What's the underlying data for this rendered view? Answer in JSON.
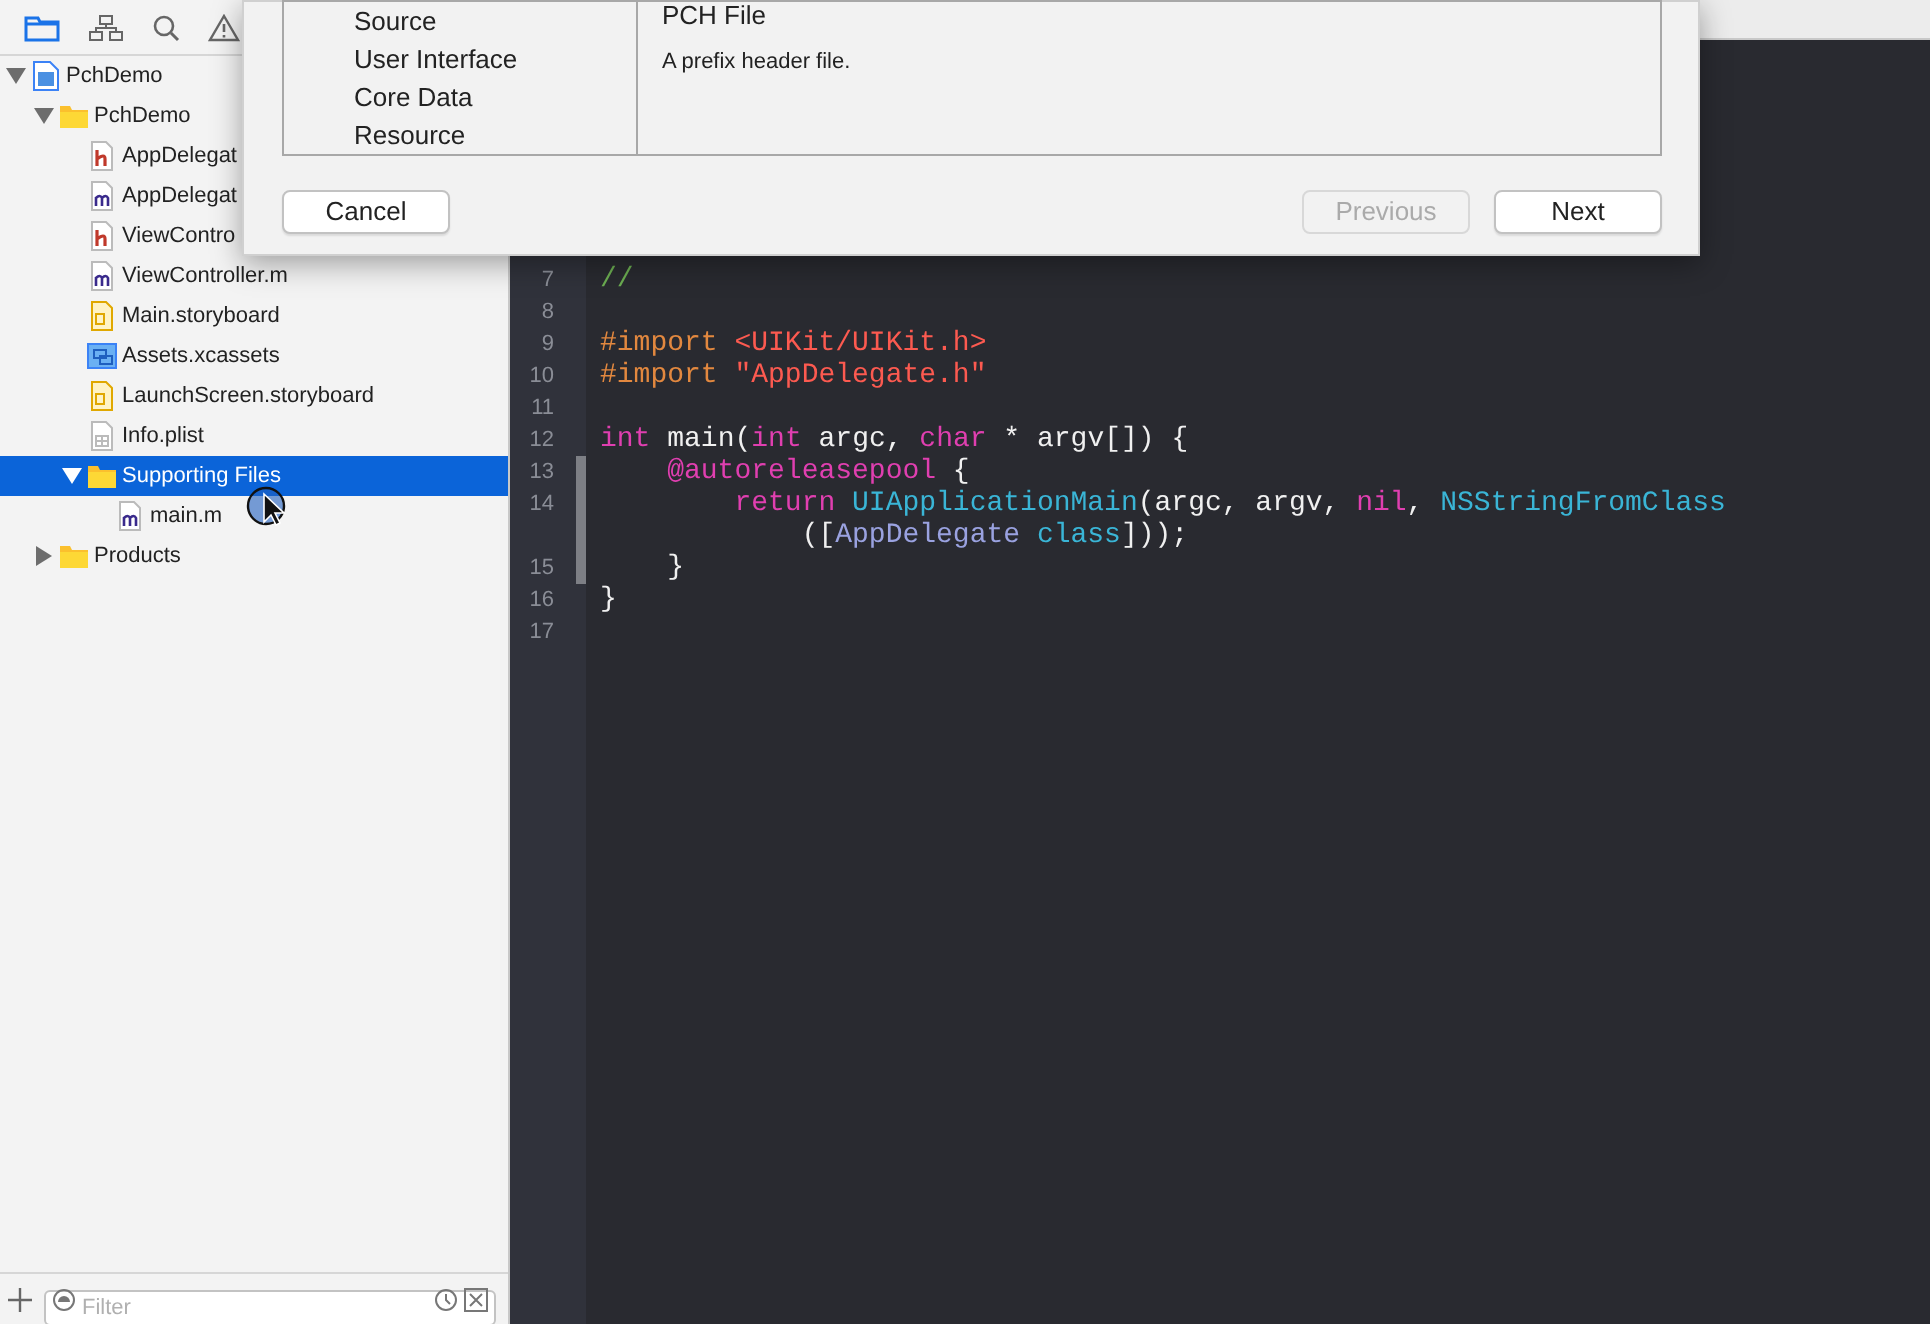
{
  "navigator": {
    "tree": [
      {
        "label": "PchDemo",
        "kind": "project",
        "expanded": true,
        "selected": false,
        "children": [
          {
            "label": "PchDemo",
            "kind": "folder",
            "expanded": true,
            "selected": false,
            "children": [
              {
                "label": "AppDelegat",
                "kind": "h",
                "selected": false
              },
              {
                "label": "AppDelegat",
                "kind": "m",
                "selected": false
              },
              {
                "label": "ViewContro",
                "kind": "h",
                "selected": false
              },
              {
                "label": "ViewController.m",
                "kind": "m",
                "selected": false
              },
              {
                "label": "Main.storyboard",
                "kind": "storyboard",
                "selected": false
              },
              {
                "label": "Assets.xcassets",
                "kind": "assets",
                "selected": false
              },
              {
                "label": "LaunchScreen.storyboard",
                "kind": "storyboard",
                "selected": false
              },
              {
                "label": "Info.plist",
                "kind": "plist",
                "selected": false
              },
              {
                "label": "Supporting Files",
                "kind": "folder",
                "expanded": true,
                "selected": true,
                "children": [
                  {
                    "label": "main.m",
                    "kind": "m",
                    "selected": false
                  }
                ]
              }
            ]
          },
          {
            "label": "Products",
            "kind": "folder",
            "expanded": false,
            "selected": false
          }
        ]
      }
    ],
    "filter": {
      "placeholder": "Filter"
    }
  },
  "editor": {
    "lines": [
      {
        "number": "7",
        "changed": false,
        "tokens": [
          {
            "text": "//",
            "kind": "comment"
          }
        ]
      },
      {
        "number": "8",
        "changed": false
      },
      {
        "number": "9",
        "changed": false,
        "tokens": [
          {
            "text": "#import ",
            "kind": "directive"
          },
          {
            "text": "<UIKit/UIKit.h>",
            "kind": "string"
          }
        ]
      },
      {
        "number": "10",
        "changed": false,
        "tokens": [
          {
            "text": "#import ",
            "kind": "directive"
          },
          {
            "text": "\"AppDelegate.h\"",
            "kind": "string"
          }
        ]
      },
      {
        "number": "11",
        "changed": false
      },
      {
        "number": "12",
        "changed": false,
        "tokens": [
          {
            "text": "int",
            "kind": "keyword"
          },
          {
            "text": " main(",
            "kind": "plain"
          },
          {
            "text": "int",
            "kind": "keyword"
          },
          {
            "text": " argc, ",
            "kind": "plain"
          },
          {
            "text": "char",
            "kind": "keyword"
          },
          {
            "text": " * argv[]) {",
            "kind": "plain"
          }
        ]
      },
      {
        "number": "13",
        "changed": true,
        "tokens": [
          {
            "text": "    @autoreleasepool",
            "kind": "keyword"
          },
          {
            "text": " {",
            "kind": "plain"
          }
        ]
      },
      {
        "number": "14",
        "changed": true,
        "tokens": [
          {
            "text": "        return",
            "kind": "keyword"
          },
          {
            "text": " UIApplicationMain",
            "kind": "system"
          },
          {
            "text": "(argc, argv, ",
            "kind": "plain"
          },
          {
            "text": "nil",
            "kind": "keyword"
          },
          {
            "text": ", ",
            "kind": "plain"
          },
          {
            "text": "NSStringFromClass",
            "kind": "system"
          }
        ],
        "wrap": [
          {
            "text": "            ([",
            "kind": "plain"
          },
          {
            "text": "AppDelegate",
            "kind": "project"
          },
          {
            "text": " class",
            "kind": "system"
          },
          {
            "text": "]));",
            "kind": "plain"
          }
        ]
      },
      {
        "number": "15",
        "changed": true,
        "tokens": [
          {
            "text": "    }",
            "kind": "plain"
          }
        ]
      },
      {
        "number": "16",
        "changed": false,
        "tokens": [
          {
            "text": "}",
            "kind": "plain"
          }
        ]
      },
      {
        "number": "17",
        "changed": false
      }
    ]
  },
  "dialog": {
    "categories": [
      "Source",
      "User Interface",
      "Core Data",
      "Resource"
    ],
    "template": {
      "title": "PCH File",
      "description": "A prefix header file."
    },
    "buttons": [
      {
        "label": "Cancel",
        "disabled": false
      },
      {
        "label": "Previous",
        "disabled": true
      },
      {
        "label": "Next",
        "disabled": false
      }
    ]
  }
}
